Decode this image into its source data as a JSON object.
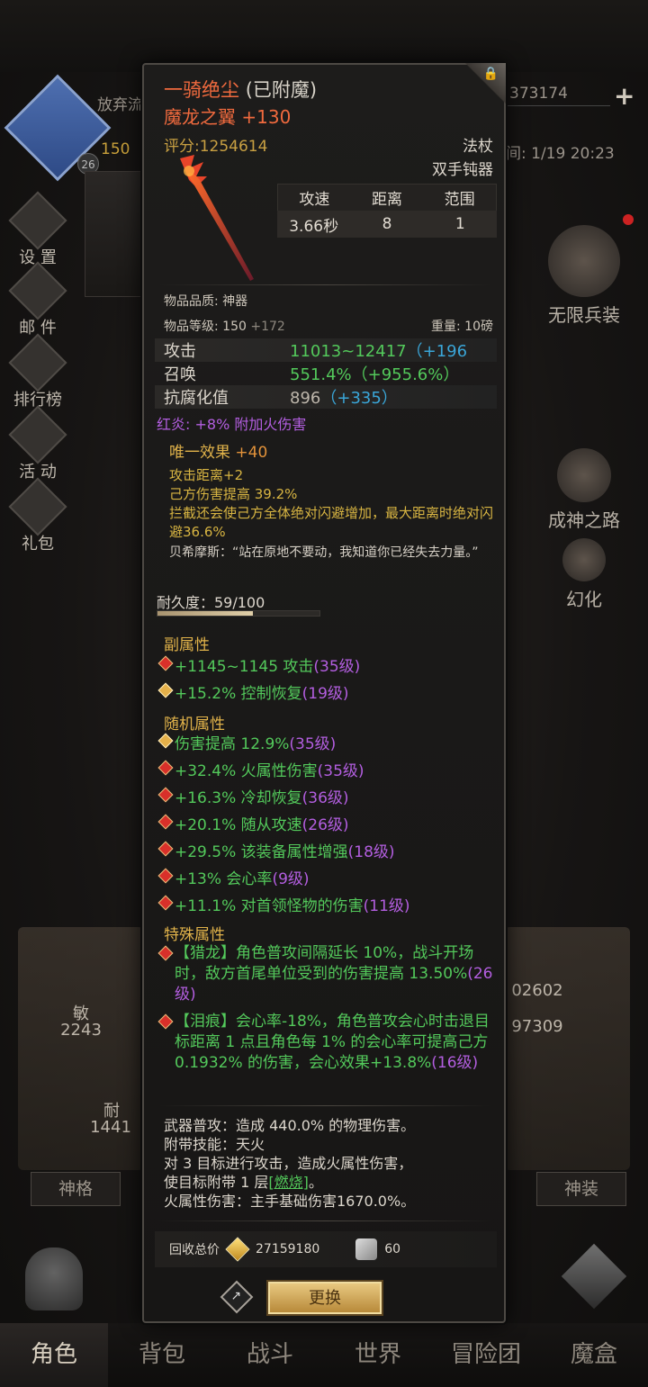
{
  "background": {
    "abandon_text": "放弃流",
    "avatar_level": "26",
    "gold_text": "150",
    "resource_value": "373174",
    "time_text": "间: 1/19 20:23",
    "left_menu": [
      "设 置",
      "邮 件",
      "排行榜",
      "活 动",
      "礼包"
    ],
    "right_items": [
      "无限兵装",
      "成神之路",
      "幻化"
    ],
    "stats_left": {
      "agi_label": "敏",
      "agi_value": "2243",
      "dur_label": "耐",
      "dur_value": "1441"
    },
    "stats_right": {
      "value1": "02602",
      "value2": "97309"
    },
    "buttons": {
      "shen_ge": "神格",
      "shen_zhuang": "神装"
    },
    "bottom_nav": [
      "角色",
      "背包",
      "战斗",
      "世界",
      "冒险团",
      "魔盒"
    ],
    "active_tab": "角色"
  },
  "item": {
    "name": "一骑绝尘",
    "name_tag": "(已附魔)",
    "enchant": "魔龙之翼 +130",
    "score": "评分:1254614",
    "weapon_type": "法杖",
    "weapon_sub": "双手钝器",
    "table_headers": [
      "攻速",
      "距离",
      "范围"
    ],
    "table_values": [
      "3.66秒",
      "8",
      "1"
    ],
    "quality": "物品品质: 神器",
    "level_label": "物品等级: 150",
    "level_bonus": "+172",
    "weight": "重量: 10磅",
    "main_stats": [
      {
        "key": "攻击",
        "value": "11013~12417",
        "add": "（+196"
      },
      {
        "key": "召唤",
        "value": "551.4%",
        "add": "（+955.6%）"
      },
      {
        "key": "抗腐化值",
        "value": "896",
        "add": "（+335）"
      }
    ],
    "red_flame": "红炎: +8% 附加火伤害",
    "unique_title": "唯一效果",
    "unique_num": "+40",
    "unique_lines": [
      "攻击距离+2",
      "己方伤害提高 39.2%",
      "拦截还会使己方全体绝对闪避增加，最大距离时绝对闪避36.6%"
    ],
    "quote": "贝希摩斯：“站在原地不要动，我知道你已经失去力量。”",
    "durability_label": "耐久度：59/100",
    "durability_fraction": 0.59,
    "sub_title": "副属性",
    "sub_attrs": [
      {
        "text": "+1145~1145 攻击 ",
        "lv": "(35级)",
        "gem": "red"
      },
      {
        "text": "+15.2% 控制恢复",
        "lv": "(19级)",
        "gem": "gold"
      }
    ],
    "random_title": "随机属性",
    "random_attrs": [
      {
        "text": "伤害提高 12.9%",
        "lv": "(35级)",
        "gem": "gold"
      },
      {
        "text": "+32.4% 火属性伤害",
        "lv": "(35级)",
        "gem": "red"
      },
      {
        "text": "+16.3% 冷却恢复",
        "lv": "(36级)",
        "gem": "red"
      },
      {
        "text": "+20.1% 随从攻速",
        "lv": "(26级)",
        "gem": "red"
      },
      {
        "text": "+29.5% 该装备属性增强",
        "lv": "(18级)",
        "gem": "red"
      },
      {
        "text": "+13% 会心率",
        "lv": "(9级)",
        "gem": "red"
      },
      {
        "text": "+11.1% 对首领怪物的伤害",
        "lv": "(11级)",
        "gem": "red"
      }
    ],
    "special_title": "特殊属性",
    "special_attrs": [
      {
        "text": "【猎龙】角色普攻间隔延长 10%，战斗开场时，敌方首尾单位受到的伤害提高 13.50%",
        "lv": "(26级)"
      },
      {
        "text": "【泪痕】会心率-18%，角色普攻会心时击退目标距离 1 点且角色每 1% 的会心率可提高己方 0.1932% 的伤害，会心效果+13.8%",
        "lv": "(16级)"
      }
    ],
    "skill_line1": "武器普攻：造成 440.0% 的物理伤害。",
    "skill_line2": "附带技能：天火",
    "skill_line3": "对 3 目标进行攻击，造成火属性伤害，",
    "skill_line4a": "使目标附带 1 层",
    "skill_burn": "[燃烧]",
    "skill_line4b": "。",
    "skill_line5": "火属性伤害：主手基础伤害1670.0%。",
    "recycle_label": "回收总价",
    "recycle_gold": "27159180",
    "recycle_scroll": "60",
    "swap_button": "更换"
  }
}
